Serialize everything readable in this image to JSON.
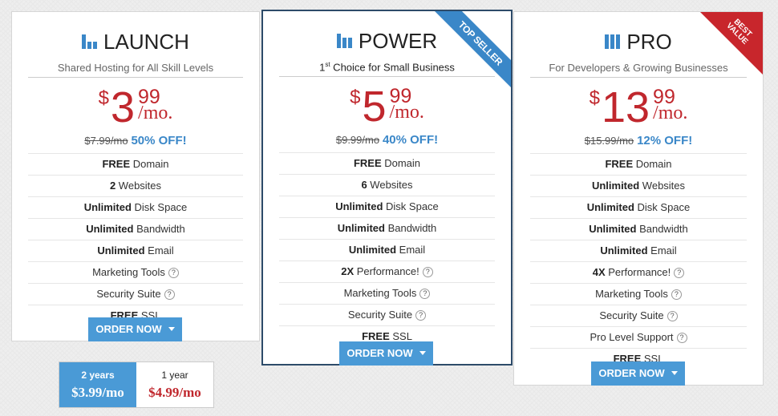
{
  "colors": {
    "accent": "#3a87c8",
    "price": "#c0272d",
    "featured_border": "#2d4b69",
    "best_value": "#c8262c"
  },
  "plans": [
    {
      "name": "LAUNCH",
      "icon": "bar-chart-icon",
      "subtitle": "Shared Hosting for All Skill Levels",
      "currency": "$",
      "dollars": "3",
      "cents": "99",
      "per": "/mo.",
      "old_price": "$7.99/mo",
      "discount": "50% OFF!",
      "features": [
        {
          "b": "FREE",
          "t": " Domain"
        },
        {
          "b": "2",
          "t": " Websites"
        },
        {
          "b": "Unlimited",
          "t": " Disk Space"
        },
        {
          "b": "Unlimited",
          "t": " Bandwidth"
        },
        {
          "b": "Unlimited",
          "t": " Email"
        },
        {
          "b": "",
          "t": "Marketing Tools",
          "q": true
        },
        {
          "b": "",
          "t": "Security Suite",
          "q": true
        },
        {
          "b": "FREE",
          "t": " SSL"
        }
      ],
      "button": "ORDER NOW"
    },
    {
      "name": "POWER",
      "icon": "bar-chart-icon",
      "subtitle_pre": "1",
      "subtitle_sup": "st",
      "subtitle": " Choice for Small Business",
      "currency": "$",
      "dollars": "5",
      "cents": "99",
      "per": "/mo.",
      "old_price": "$9.99/mo",
      "discount": "40% OFF!",
      "ribbon": "TOP SELLER",
      "features": [
        {
          "b": "FREE",
          "t": " Domain"
        },
        {
          "b": "6",
          "t": " Websites"
        },
        {
          "b": "Unlimited",
          "t": " Disk Space"
        },
        {
          "b": "Unlimited",
          "t": " Bandwidth"
        },
        {
          "b": "Unlimited",
          "t": " Email"
        },
        {
          "b": "2X",
          "t": " Performance!",
          "q": true
        },
        {
          "b": "",
          "t": "Marketing Tools",
          "q": true
        },
        {
          "b": "",
          "t": "Security Suite",
          "q": true
        },
        {
          "b": "FREE",
          "t": " SSL"
        }
      ],
      "button": "ORDER NOW"
    },
    {
      "name": "PRO",
      "icon": "bar-chart-icon",
      "subtitle": "For Developers & Growing Businesses",
      "currency": "$",
      "dollars": "13",
      "cents": "99",
      "per": "/mo.",
      "old_price": "$15.99/mo",
      "discount": "12% OFF!",
      "corner": "BEST VALUE",
      "features": [
        {
          "b": "FREE",
          "t": " Domain"
        },
        {
          "b": "Unlimited",
          "t": " Websites"
        },
        {
          "b": "Unlimited",
          "t": " Disk Space"
        },
        {
          "b": "Unlimited",
          "t": " Bandwidth"
        },
        {
          "b": "Unlimited",
          "t": " Email"
        },
        {
          "b": "4X",
          "t": " Performance!",
          "q": true
        },
        {
          "b": "",
          "t": "Marketing Tools",
          "q": true
        },
        {
          "b": "",
          "t": "Security Suite",
          "q": true
        },
        {
          "b": "",
          "t": "Pro Level Support",
          "q": true
        },
        {
          "b": "FREE",
          "t": " SSL"
        }
      ],
      "button": "ORDER NOW"
    }
  ],
  "term_popup": {
    "options": [
      {
        "term": "2 years",
        "price": "$3.99/mo",
        "selected": true
      },
      {
        "term": "1 year",
        "price": "$4.99/mo",
        "selected": false
      }
    ]
  }
}
